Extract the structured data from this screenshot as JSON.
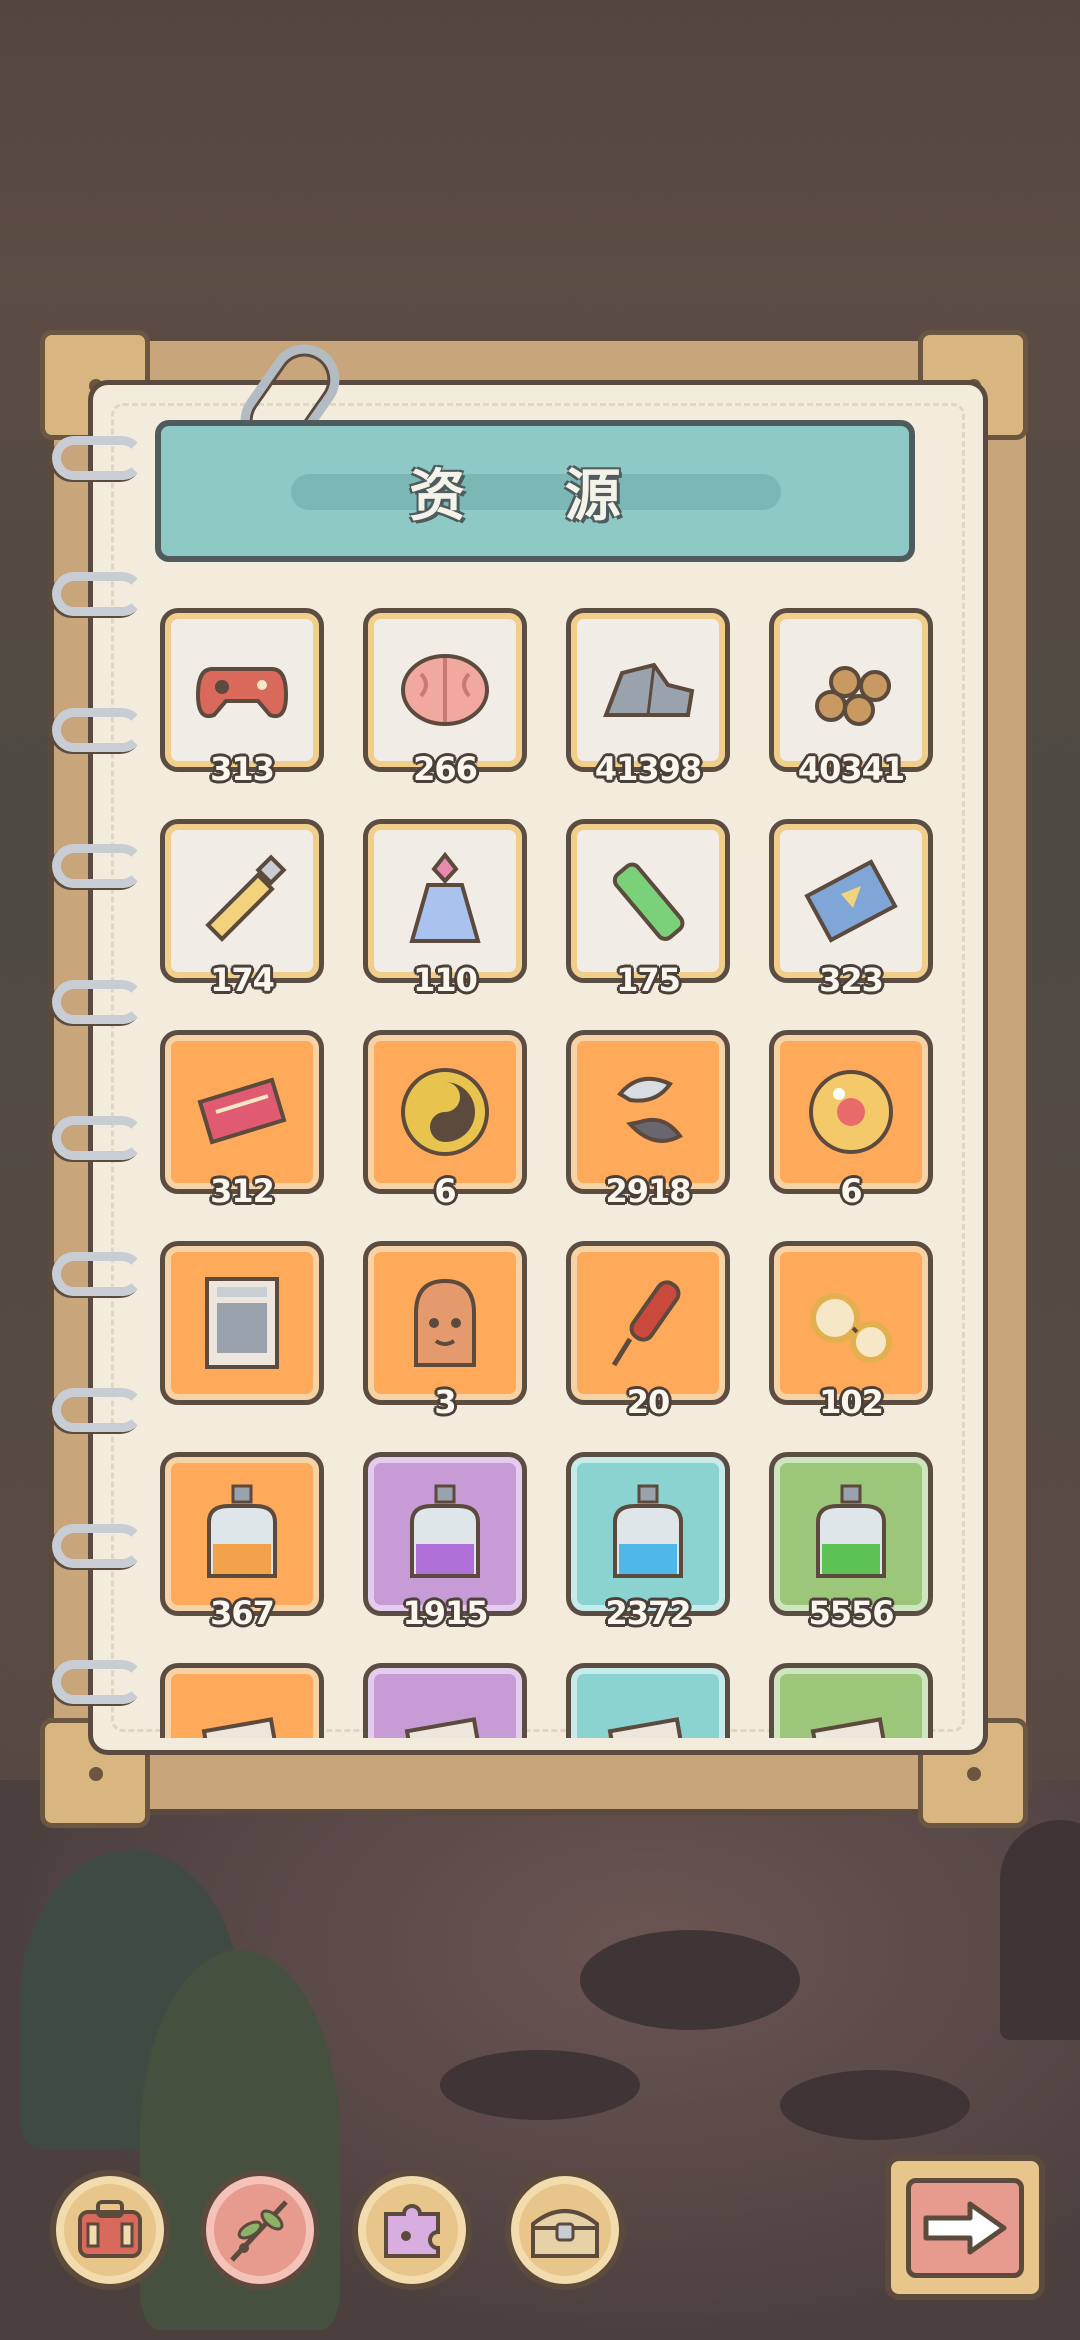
{
  "title": "资 源",
  "items": [
    {
      "icon": "gamepad-icon",
      "tile": "white",
      "count": "313"
    },
    {
      "icon": "brain-icon",
      "tile": "white",
      "count": "266"
    },
    {
      "icon": "stone-icon",
      "tile": "white",
      "count": "41398"
    },
    {
      "icon": "wood-logs-icon",
      "tile": "white",
      "count": "40341"
    },
    {
      "icon": "paint-tube-icon",
      "tile": "white",
      "count": "174"
    },
    {
      "icon": "perfume-bottle-icon",
      "tile": "white",
      "count": "110"
    },
    {
      "icon": "battery-tube-icon",
      "tile": "white",
      "count": "175"
    },
    {
      "icon": "film-strip-icon",
      "tile": "white",
      "count": "323"
    },
    {
      "icon": "ticket-icon",
      "tile": "orange",
      "count": "312"
    },
    {
      "icon": "yin-yang-coin-icon",
      "tile": "orange",
      "count": "6"
    },
    {
      "icon": "koi-fish-icon",
      "tile": "orange",
      "count": "2918"
    },
    {
      "icon": "crystal-ball-icon",
      "tile": "orange",
      "count": "6"
    },
    {
      "icon": "book-icon",
      "tile": "orange",
      "count": ""
    },
    {
      "icon": "idol-head-icon",
      "tile": "orange",
      "count": "3"
    },
    {
      "icon": "firework-stick-icon",
      "tile": "orange",
      "count": "20"
    },
    {
      "icon": "glasses-icon",
      "tile": "orange",
      "count": "102"
    },
    {
      "icon": "orange-potion-icon",
      "tile": "orange",
      "count": "367"
    },
    {
      "icon": "purple-potion-icon",
      "tile": "purple",
      "count": "1915"
    },
    {
      "icon": "blue-potion-icon",
      "tile": "cyan",
      "count": "2372"
    },
    {
      "icon": "green-potion-icon",
      "tile": "green",
      "count": "5556"
    },
    {
      "icon": "orange-card-icon",
      "tile": "orange",
      "count": ""
    },
    {
      "icon": "purple-card-icon",
      "tile": "purple",
      "count": ""
    },
    {
      "icon": "blue-card-icon",
      "tile": "cyan",
      "count": ""
    },
    {
      "icon": "green-card-icon",
      "tile": "green",
      "count": ""
    }
  ],
  "bottom_nav": [
    {
      "icon": "backpack-icon"
    },
    {
      "icon": "leaf-branch-icon",
      "active": true
    },
    {
      "icon": "puzzle-piece-icon"
    },
    {
      "icon": "treasure-chest-icon"
    }
  ],
  "next_button": {
    "icon": "arrow-right-icon"
  }
}
